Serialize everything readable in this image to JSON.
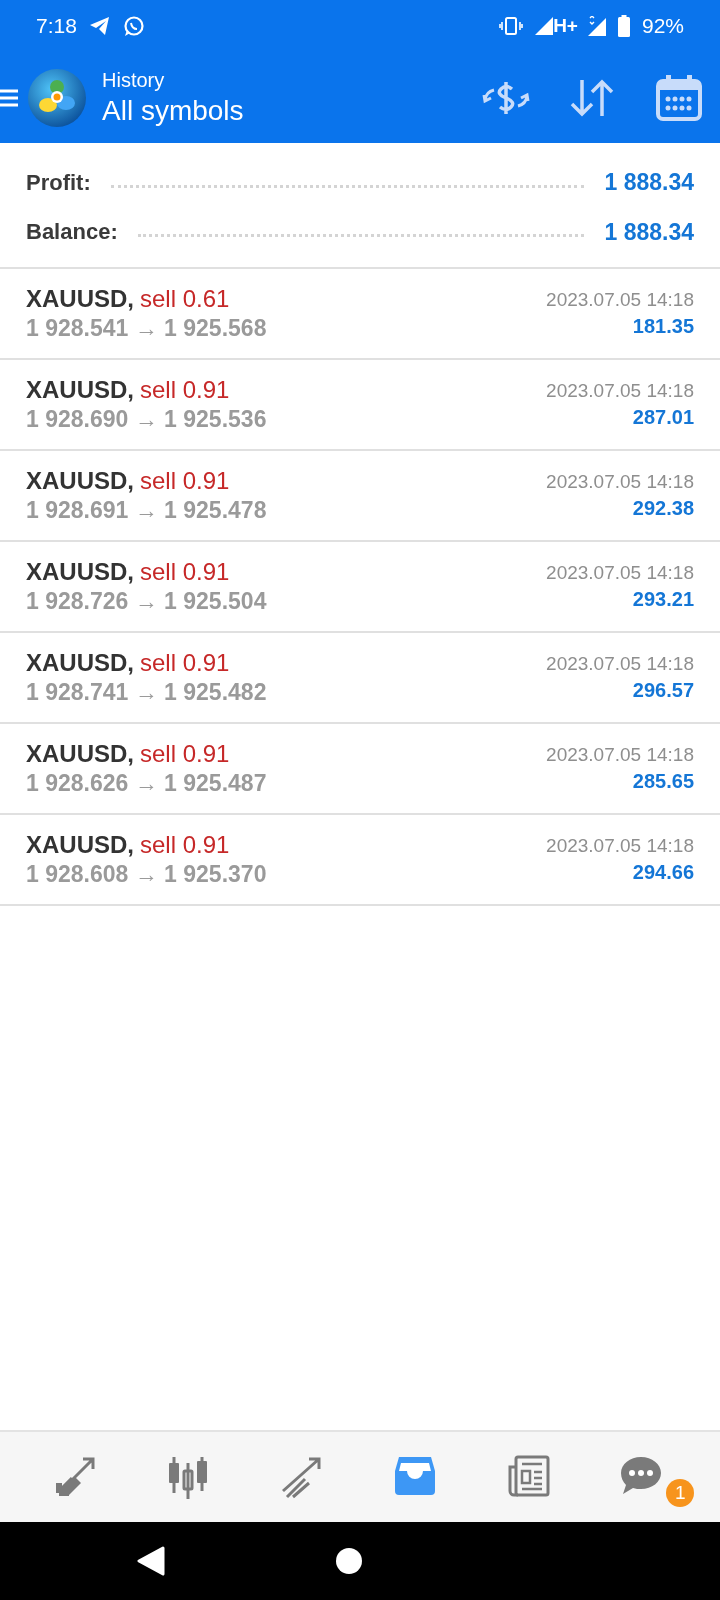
{
  "status_bar": {
    "time": "7:18",
    "battery": "92%",
    "network": "H+"
  },
  "app_bar": {
    "subtitle": "History",
    "title": "All symbols"
  },
  "summary": [
    {
      "label": "Profit:",
      "value": "1 888.34"
    },
    {
      "label": "Balance:",
      "value": "1 888.34"
    }
  ],
  "deals": [
    {
      "symbol": "XAUUSD,",
      "deal": "sell 0.61",
      "prices": "1 928.541 → 1 925.568",
      "time": "2023.07.05 14:18",
      "profit": "181.35"
    },
    {
      "symbol": "XAUUSD,",
      "deal": "sell 0.91",
      "prices": "1 928.690 → 1 925.536",
      "time": "2023.07.05 14:18",
      "profit": "287.01"
    },
    {
      "symbol": "XAUUSD,",
      "deal": "sell 0.91",
      "prices": "1 928.691 → 1 925.478",
      "time": "2023.07.05 14:18",
      "profit": "292.38"
    },
    {
      "symbol": "XAUUSD,",
      "deal": "sell 0.91",
      "prices": "1 928.726 → 1 925.504",
      "time": "2023.07.05 14:18",
      "profit": "293.21"
    },
    {
      "symbol": "XAUUSD,",
      "deal": "sell 0.91",
      "prices": "1 928.741 → 1 925.482",
      "time": "2023.07.05 14:18",
      "profit": "296.57"
    },
    {
      "symbol": "XAUUSD,",
      "deal": "sell 0.91",
      "prices": "1 928.626 → 1 925.487",
      "time": "2023.07.05 14:18",
      "profit": "285.65"
    },
    {
      "symbol": "XAUUSD,",
      "deal": "sell 0.91",
      "prices": "1 928.608 → 1 925.370",
      "time": "2023.07.05 14:18",
      "profit": "294.66"
    }
  ],
  "bottom_nav": [
    {
      "kind": "quotes",
      "selected": false
    },
    {
      "kind": "chart",
      "selected": false
    },
    {
      "kind": "trade",
      "selected": false
    },
    {
      "kind": "history",
      "selected": true
    },
    {
      "kind": "news",
      "selected": false
    },
    {
      "kind": "chat",
      "selected": false,
      "badge": "1"
    }
  ]
}
